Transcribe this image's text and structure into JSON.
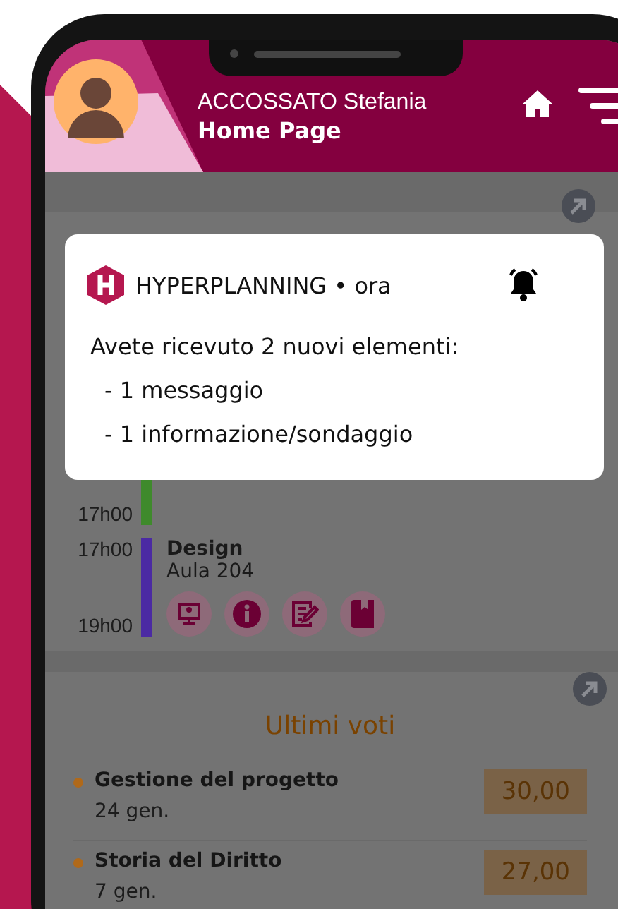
{
  "header": {
    "user_name": "ACCOSSATO Stefania",
    "page_title": "Home Page"
  },
  "notification": {
    "source": "HYPERPLANNING • ora",
    "message": "Avete ricevuto 2 nuovi elementi:",
    "items": [
      "- 1 messaggio",
      "- 1 informazione/sondaggio"
    ]
  },
  "timetable": {
    "lessons": [
      {
        "end": "17h00",
        "color": "#3f8a2c"
      },
      {
        "start": "17h00",
        "end": "19h00",
        "subject": "Design",
        "room": "Aula 204",
        "color": "#4b2aa3",
        "actions": [
          {
            "kind": "screen"
          },
          {
            "kind": "info"
          },
          {
            "kind": "edit"
          },
          {
            "kind": "book"
          }
        ]
      }
    ]
  },
  "grades": {
    "title": "Ultimi voti",
    "items": [
      {
        "subject": "Gestione del progetto",
        "date": "24 gen.",
        "grade": "30,00"
      },
      {
        "subject": "Storia del Diritto",
        "date": "7 gen.",
        "grade": "27,00"
      }
    ]
  }
}
